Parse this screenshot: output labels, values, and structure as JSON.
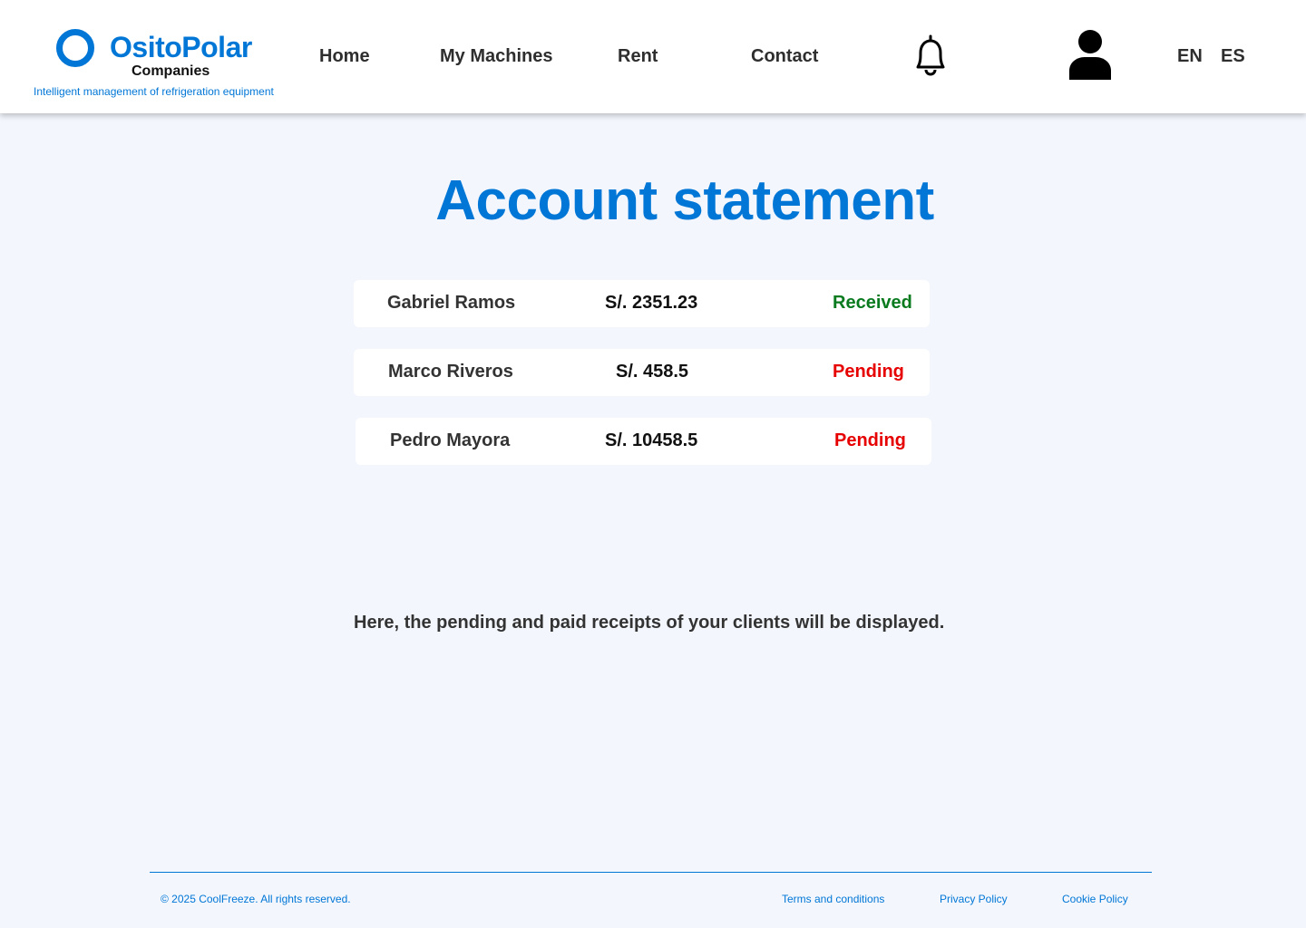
{
  "brand": {
    "name": "OsitoPolar",
    "sub": "Companies",
    "tagline": "Intelligent management of refrigeration equipment",
    "color": "#0076d6"
  },
  "nav": {
    "home": "Home",
    "machines": "My Machines",
    "rent": "Rent",
    "contact": "Contact",
    "notification_icon": "bell-icon",
    "profile_icon": "user-icon"
  },
  "languages": {
    "en": "EN",
    "es": "ES"
  },
  "page": {
    "title": "Account statement",
    "info": "Here, the pending and paid receipts of your clients will be displayed."
  },
  "statements": [
    {
      "client": "Gabriel Ramos",
      "amount": "S/. 2351.23",
      "status": "Received",
      "status_color": "#0a7a1f"
    },
    {
      "client": "Marco Riveros",
      "amount": "S/. 458.5",
      "status": "Pending",
      "status_color": "#e60000"
    },
    {
      "client": "Pedro Mayora",
      "amount": "S/. 10458.5",
      "status": "Pending",
      "status_color": "#e60000"
    }
  ],
  "footer": {
    "copyright": "© 2025 CoolFreeze. All rights reserved.",
    "terms": "Terms and conditions",
    "privacy": "Privacy Policy",
    "cookie": "Cookie Policy"
  }
}
